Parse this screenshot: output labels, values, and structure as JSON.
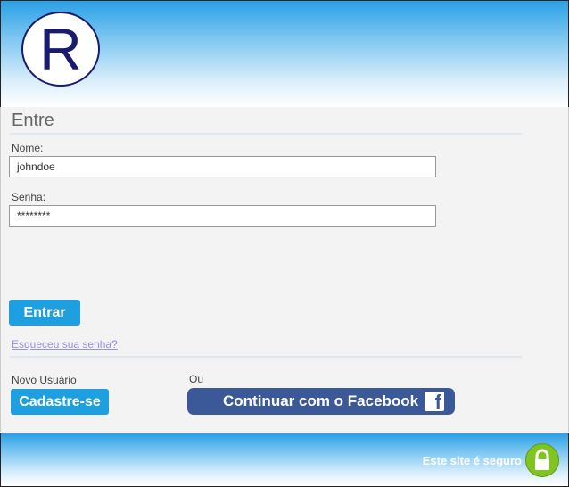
{
  "header": {
    "logo_letter": "R"
  },
  "form": {
    "title": "Entre",
    "name_label": "Nome:",
    "name_value": "johndoe",
    "password_label": "Senha:",
    "password_value": "********",
    "submit_label": "Entrar",
    "forgot_link": "Esqueceu sua senha?"
  },
  "register": {
    "label": "Novo Usuário",
    "button": "Cadastre-se",
    "or_label": "Ou",
    "facebook_button": "Continuar com o Facebook"
  },
  "footer": {
    "secure_text": "Este site é seguro"
  },
  "colors": {
    "accent": "#1ea0e0",
    "facebook": "#3b5998",
    "lock": "#7fc421",
    "link": "#9b8fe0"
  }
}
